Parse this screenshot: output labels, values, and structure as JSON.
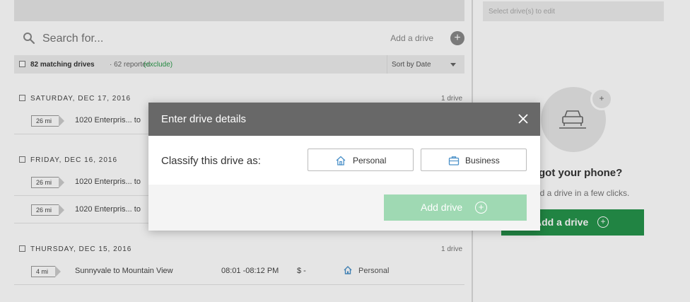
{
  "search": {
    "placeholder": "Search for..."
  },
  "toolbar": {
    "add_drive_label": "Add a drive",
    "add_plus": "+"
  },
  "filter": {
    "matching": "82 matching drives",
    "reported": "· 62 reported",
    "exclude": "(exclude)",
    "sort": "Sort by Date"
  },
  "days": [
    {
      "date": "SATURDAY, DEC 17, 2016",
      "count": "1 drive",
      "drives": [
        {
          "miles": "26 mi",
          "route": "1020 Enterpris...  to"
        }
      ]
    },
    {
      "date": "FRIDAY, DEC 16, 2016",
      "count": "",
      "drives": [
        {
          "miles": "26 mi",
          "route": "1020 Enterpris...  to"
        },
        {
          "miles": "26 mi",
          "route": "1020 Enterpris...  to"
        }
      ]
    },
    {
      "date": "THURSDAY, DEC 15, 2016",
      "count": "1 drive",
      "drives": [
        {
          "miles": "4 mi",
          "route": "Sunnyvale to Mountain View",
          "time": "08:01 -08:12 PM",
          "amount": "$ -",
          "classification": "Personal"
        }
      ]
    }
  ],
  "right_panel": {
    "edit_placeholder": "Select drive(s) to edit",
    "badge_plus": "+",
    "title": "got your phone?",
    "subtitle": "dd a drive in a few clicks.",
    "button": "Add a drive",
    "button_plus": "+"
  },
  "modal": {
    "title": "Enter drive details",
    "classify_label": "Classify this drive as:",
    "personal": "Personal",
    "business": "Business",
    "add_button": "Add drive",
    "add_plus": "+"
  },
  "colors": {
    "accent_green": "#25944b",
    "disabled_green": "#9fd9b3",
    "modal_header": "#686868",
    "link_green": "#2a9a4a"
  },
  "icons": [
    "search-icon",
    "add-circle-icon",
    "house-icon",
    "briefcase-icon",
    "close-icon",
    "car-icon",
    "plus-circle-icon",
    "caret-down-icon"
  ]
}
